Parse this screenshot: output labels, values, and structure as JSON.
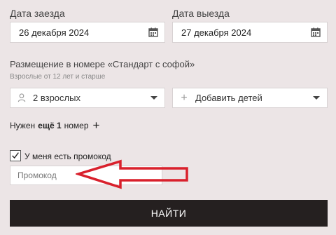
{
  "dates": {
    "checkin_label": "Дата заезда",
    "checkin_value": "26 декабря 2024",
    "checkout_label": "Дата выезда",
    "checkout_value": "27 декабря 2024"
  },
  "room": {
    "title": "Размещение в номере «Стандарт с софой»",
    "subtitle": "Взрослые от 12 лет и старше",
    "adults_value": "2 взрослых",
    "children_value": "Добавить детей"
  },
  "more_rooms": {
    "prefix": "Нужен",
    "bold": "ещё 1",
    "suffix": "номер"
  },
  "promo": {
    "checkbox_label": "У меня есть промокод",
    "checked": true,
    "placeholder": "Промокод"
  },
  "submit_label": "НАЙТИ",
  "icons": [
    "calendar-icon",
    "person-icon",
    "plus-icon",
    "caret-down-icon",
    "checkmark-icon",
    "plus-icon"
  ],
  "colors": {
    "annotation_arrow": "#d9202c",
    "button_bg": "#252020"
  }
}
